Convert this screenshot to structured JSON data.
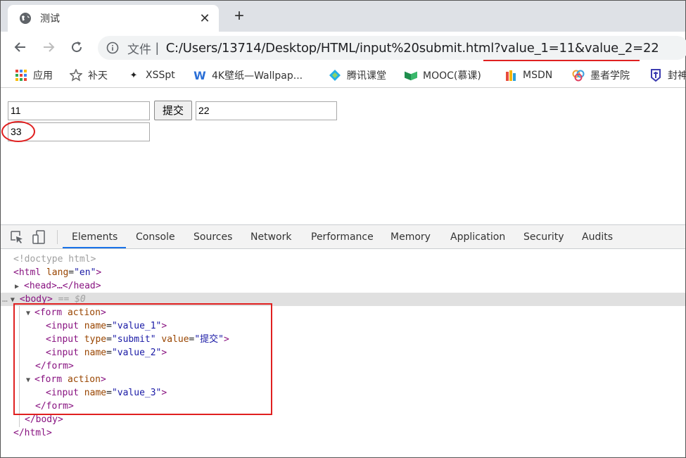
{
  "tab": {
    "title": "测试",
    "close": "✕",
    "newtab": "+"
  },
  "address": {
    "scheme": "文件",
    "separator": "|",
    "url": "C:/Users/13714/Desktop/HTML/input%20submit.html?value_1=11&value_2=22"
  },
  "bookmarks": [
    {
      "label": "应用",
      "icon": "apps-grid-icon"
    },
    {
      "label": "补天",
      "icon": "star-icon"
    },
    {
      "label": "XSSpt",
      "icon": "xss-icon"
    },
    {
      "label": "4K壁纸—Wallpap...",
      "icon": "wallpaper-icon"
    },
    {
      "label": "腾讯课堂",
      "icon": "tencent-class-icon"
    },
    {
      "label": "MOOC(慕课)",
      "icon": "mooc-icon"
    },
    {
      "label": "MSDN",
      "icon": "msdn-icon"
    },
    {
      "label": "墨者学院",
      "icon": "mozhe-icon"
    },
    {
      "label": "封神",
      "icon": "fengshen-icon"
    }
  ],
  "form": {
    "value_1": "11",
    "submit_label": "提交",
    "value_2": "22",
    "value_3": "33"
  },
  "devtools": {
    "tabs": [
      "Elements",
      "Console",
      "Sources",
      "Network",
      "Performance",
      "Memory",
      "Application",
      "Security",
      "Audits"
    ],
    "active_tab": "Elements",
    "lines": {
      "doctype": "<!doctype html>",
      "html_open_tag": "<html",
      "html_lang_attr": " lang",
      "html_lang_val": "\"en\"",
      "head_collapsed": "<head>…</head>",
      "body": "<body>",
      "body_ref": " == $0",
      "form_action": "action",
      "input_name": "name",
      "input_type": "type",
      "input_value_attr": "value",
      "val_value_1": "\"value_1\"",
      "val_submit": "\"submit\"",
      "val_tijiao": "\"提交\"",
      "val_value_2": "\"value_2\"",
      "val_value_3": "\"value_3\"",
      "form_close": "</form>",
      "body_close": "</body>",
      "html_close": "</html>"
    }
  },
  "colors": {
    "highlight": "#e02020",
    "tag": "#881280",
    "attr": "#994500",
    "value": "#1a1aa6"
  }
}
